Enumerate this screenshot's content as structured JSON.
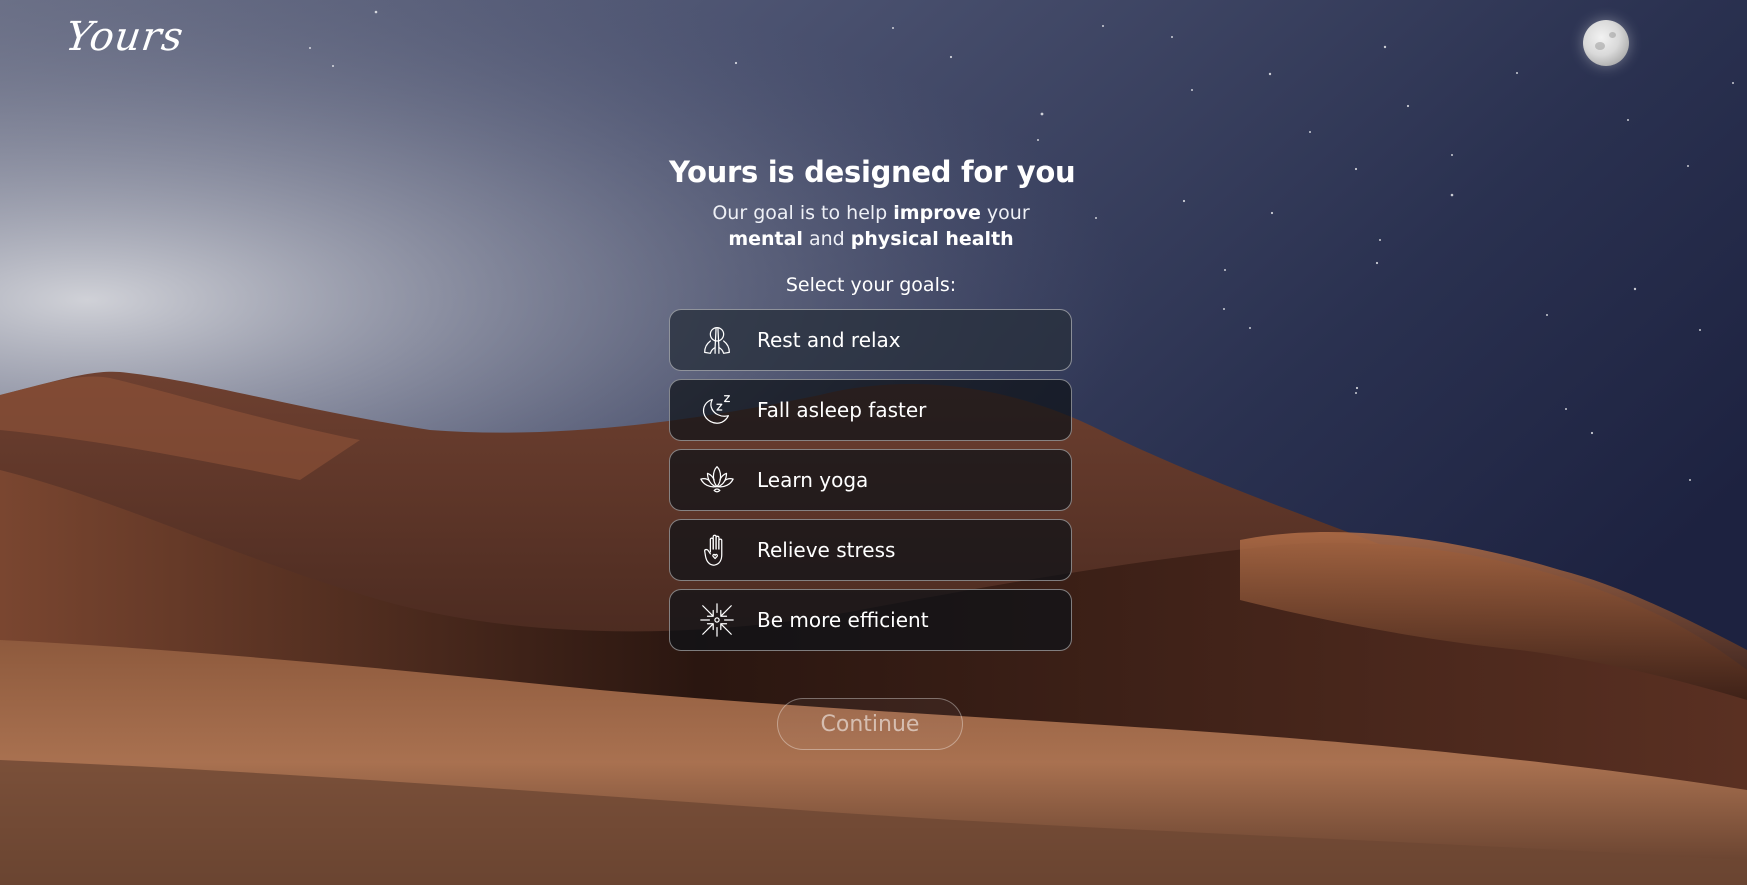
{
  "brand": {
    "logo_text": "Yours"
  },
  "hero": {
    "title": "Yours is designed for you",
    "subtitle": {
      "part1": "Our goal is to help ",
      "bold1": "improve",
      "part2": " your ",
      "bold2": "mental",
      "part3": " and ",
      "bold3": "physical health"
    },
    "select_label": "Select your goals:"
  },
  "goals": [
    {
      "label": "Rest and relax",
      "icon": "praying-hands-icon"
    },
    {
      "label": "Fall asleep faster",
      "icon": "moon-sleep-icon"
    },
    {
      "label": "Learn yoga",
      "icon": "lotus-icon"
    },
    {
      "label": "Relieve stress",
      "icon": "hand-heart-icon"
    },
    {
      "label": "Be more efficient",
      "icon": "focus-arrows-icon"
    }
  ],
  "actions": {
    "continue_label": "Continue"
  },
  "colors": {
    "sky_top": "#2a3150",
    "sky_horizon": "#c4c8d0",
    "dune_shadow": "#2a1610",
    "dune_light": "#b27a55",
    "card_bg": "#12161c",
    "card_border": "#9a9ea6"
  }
}
